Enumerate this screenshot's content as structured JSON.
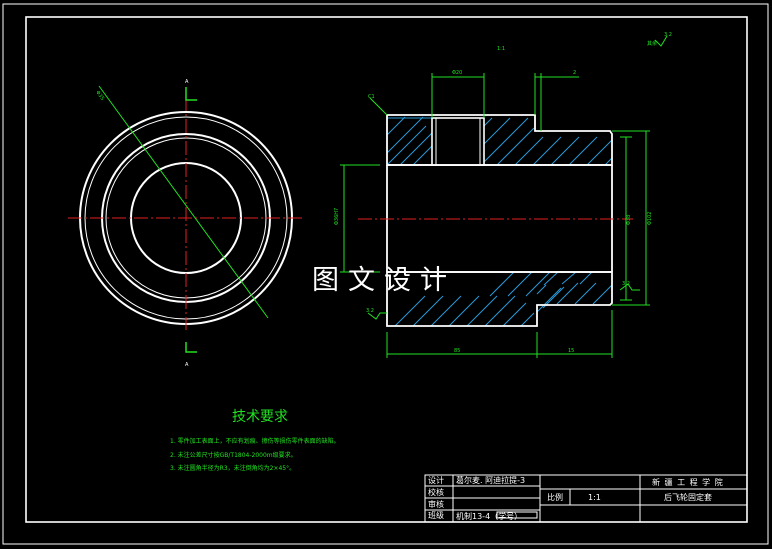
{
  "colors": {
    "background": "#000000",
    "outline": "#ffffff",
    "centerline": "#e02020",
    "dimension": "#22e022",
    "hatch": "#2a9ad8",
    "frame": "#ffffff"
  },
  "drawing": {
    "watermark": "图文设计",
    "scale_label": "1:1",
    "roughness_note": "其余",
    "roughness_value": "3.2",
    "section_top_label": "A",
    "section_bottom_label": "A",
    "diameter_callout": "Φ35",
    "chamfer_callout": "C1",
    "dim_top_width": "Φ20",
    "dim_top_small": "2",
    "dim_bore": "Φ36H7",
    "dim_inner": "Φ38",
    "dim_outer": "Φ102",
    "dim_length_left": "85",
    "dim_length_right": "15",
    "rough_left": "3.2",
    "rough_right": "3.2"
  },
  "tech_requirements": {
    "title": "技术要求",
    "items": [
      "1. 零件加工表面上，不应有划痕、擦伤等损伤零件表面的缺陷。",
      "2. 未注公差尺寸按GB/T1804-2000m级要求。",
      "3. 未注圆角半径为R3，未注倒角均为2×45°。"
    ]
  },
  "title_block": {
    "school": "新 疆 工 程 学 院",
    "part_name": "后飞轮固定套",
    "scale_label": "比例",
    "scale_value": "1:1",
    "rows": [
      {
        "role": "设计",
        "value": "葛尔麦. 阿迪拉提-3"
      },
      {
        "role": "校核",
        "value": ""
      },
      {
        "role": "审核",
        "value": ""
      },
      {
        "role": "班级",
        "value": "机制13-4（学号）"
      }
    ]
  }
}
